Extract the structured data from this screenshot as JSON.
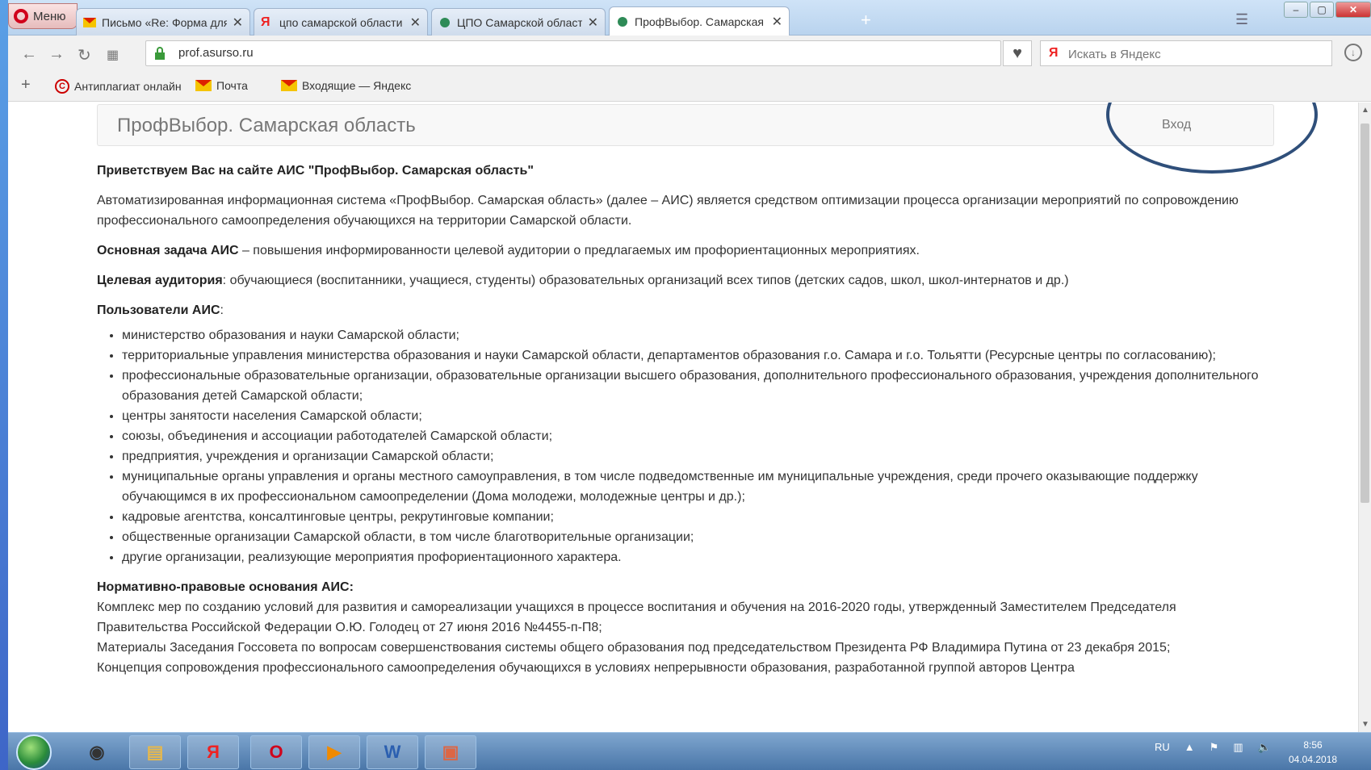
{
  "browser": {
    "menu_label": "Меню",
    "tabs": [
      {
        "label": "Письмо «Re: Форма для А",
        "icon": "mail-icon",
        "color": "#f5c400"
      },
      {
        "label": "цпо самарской области -",
        "icon": "yandex-icon",
        "color": "#e22222"
      },
      {
        "label": "ЦПО Самарской области",
        "icon": "site-icon",
        "color": "#2e8b57"
      },
      {
        "label": "ПрофВыбор. Самарская с",
        "icon": "site-icon",
        "color": "#2e8b57"
      }
    ],
    "url": "prof.asurso.ru",
    "search_placeholder": "Искать в Яндекс",
    "bookmarks": [
      {
        "label": "Антиплагиат онлайн"
      },
      {
        "label": "Почта"
      },
      {
        "label": "Входящие — Яндекс"
      }
    ]
  },
  "site": {
    "brand": "ПрофВыбор. Самарская область",
    "login": "Вход"
  },
  "content": {
    "heading": "Приветствуем Вас на сайте АИС \"ПрофВыбор. Самарская область\"",
    "intro": "Автоматизированная информационная система «ПрофВыбор. Самарская область» (далее – АИС) является средством оптимизации процесса организации мероприятий по сопровождению профессионального самоопределения обучающихся на территории Самарской области.",
    "task_label": "Основная задача АИС",
    "task_text": " – повышения информированности целевой аудитории о предлагаемых им профориентационных мероприятиях.",
    "audience_label": "Целевая аудитория",
    "audience_text": ": обучающиеся (воспитанники, учащиеся, студенты) образовательных организаций всех типов (детских садов, школ, школ-интернатов и др.)",
    "users_label": "Пользователи АИС",
    "users_colon": ":",
    "users": [
      "министерство образования и науки Самарской области;",
      "территориальные управления министерства образования и науки Самарской области, департаментов образования г.о. Самара и г.о. Тольятти (Ресурсные центры по согласованию);",
      "профессиональные образовательные организации, образовательные организации высшего образования, дополнительного профессионального образования, учреждения дополнительного образования детей Самарской области;",
      "центры занятости населения Самарской области;",
      "союзы, объединения и ассоциации работодателей Самарской области;",
      "предприятия, учреждения и организации Самарской области;",
      "муниципальные органы управления и органы местного самоуправления, в том числе подведомственные им муниципальные учреждения, среди прочего оказывающие поддержку обучающимся в их профессиональном самоопределении (Дома молодежи, молодежные центры и др.);",
      "кадровые агентства, консалтинговые центры, рекрутинговые компании;",
      "общественные организации Самарской области, в том числе благотворительные организации;",
      "другие организации, реализующие мероприятия профориентационного характера."
    ],
    "legal_label": "Нормативно-правовые основания АИС:",
    "legal": [
      "Комплекс мер по созданию условий для развития и самореализации учащихся в процессе воспитания и обучения на 2016-2020 годы, утвержденный Заместителем Председателя Правительства Российской Федерации О.Ю. Голодец от 27 июня 2016 №4455-п-П8;",
      "Материалы Заседания Госсовета по вопросам совершенствования системы общего образования под председательством Президента РФ Владимира Путина от 23 декабря 2015;",
      "Концепция сопровождения профессионального самоопределения обучающихся в условиях непрерывности образования, разработанной группой авторов Центра"
    ]
  },
  "taskbar": {
    "lang": "RU",
    "time": "8:56",
    "date": "04.04.2018"
  }
}
